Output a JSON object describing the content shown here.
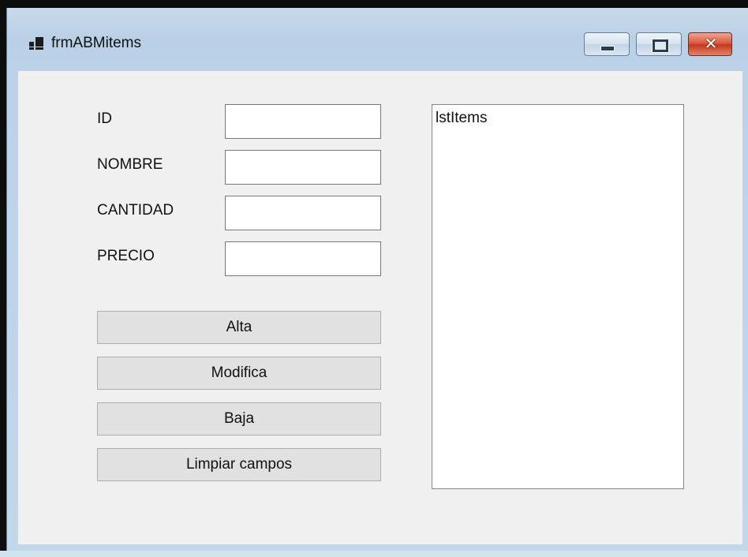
{
  "window": {
    "title": "frmABMitems"
  },
  "form": {
    "fields": [
      {
        "label": "ID",
        "value": ""
      },
      {
        "label": "NOMBRE",
        "value": ""
      },
      {
        "label": "CANTIDAD",
        "value": ""
      },
      {
        "label": "PRECIO",
        "value": ""
      }
    ],
    "buttons": [
      "Alta",
      "Modifica",
      "Baja",
      "Limpiar campos"
    ]
  },
  "list": {
    "name": "lstItems"
  }
}
